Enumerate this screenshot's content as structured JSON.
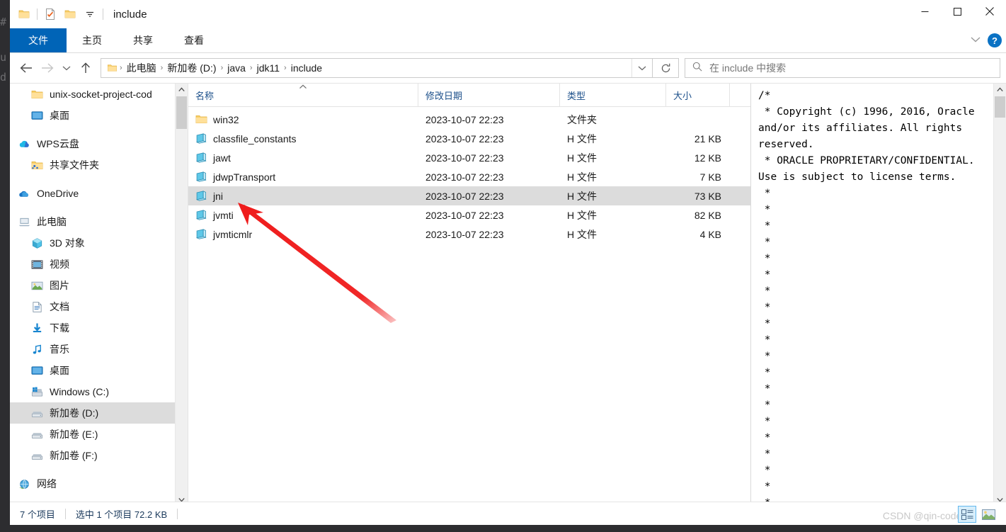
{
  "desktop": {
    "bg_lines": [
      "#",
      "u",
      "d"
    ]
  },
  "window": {
    "title": "include",
    "quick_access": [
      {
        "name": "folder-icon",
        "label": "文件夹"
      },
      {
        "name": "properties-icon",
        "label": "属性"
      },
      {
        "name": "new-folder-icon",
        "label": "新建文件夹"
      },
      {
        "name": "customize-qat-icon",
        "label": "自定义快速访问工具栏"
      }
    ],
    "controls": {
      "minimize": "—",
      "maximize": "☐",
      "close": "✕"
    }
  },
  "ribbon": {
    "tabs": [
      {
        "label": "文件",
        "active": true
      },
      {
        "label": "主页",
        "active": false
      },
      {
        "label": "共享",
        "active": false
      },
      {
        "label": "查看",
        "active": false
      }
    ],
    "collapse_label": "⌄",
    "help_label": "?"
  },
  "navbar": {
    "back_label": "←",
    "forward_label": "→",
    "recent_label": "⌄",
    "up_label": "↑",
    "breadcrumb": [
      "此电脑",
      "新加卷 (D:)",
      "java",
      "jdk11",
      "include"
    ],
    "separator": "›",
    "dropdown_label": "⌄",
    "refresh_label": "↻"
  },
  "search": {
    "placeholder": "在 include 中搜索",
    "icon": "search-icon"
  },
  "sidebar": {
    "items": [
      {
        "label": "unix-socket-project-cod",
        "icon": "folder-icon",
        "indent": 1,
        "selected": false
      },
      {
        "label": "桌面",
        "icon": "desktop-icon",
        "indent": 1,
        "selected": false
      },
      {
        "gap": true
      },
      {
        "label": "WPS云盘",
        "icon": "wps-cloud-icon",
        "indent": 0,
        "selected": false
      },
      {
        "label": "共享文件夹",
        "icon": "shared-folder-icon",
        "indent": 1,
        "selected": false
      },
      {
        "gap": true
      },
      {
        "label": "OneDrive",
        "icon": "onedrive-icon",
        "indent": 0,
        "selected": false
      },
      {
        "gap": true
      },
      {
        "label": "此电脑",
        "icon": "this-pc-icon",
        "indent": 0,
        "selected": false
      },
      {
        "label": "3D 对象",
        "icon": "3d-objects-icon",
        "indent": 1,
        "selected": false
      },
      {
        "label": "视频",
        "icon": "videos-icon",
        "indent": 1,
        "selected": false
      },
      {
        "label": "图片",
        "icon": "pictures-icon",
        "indent": 1,
        "selected": false
      },
      {
        "label": "文档",
        "icon": "documents-icon",
        "indent": 1,
        "selected": false
      },
      {
        "label": "下载",
        "icon": "downloads-icon",
        "indent": 1,
        "selected": false
      },
      {
        "label": "音乐",
        "icon": "music-icon",
        "indent": 1,
        "selected": false
      },
      {
        "label": "桌面",
        "icon": "desktop-icon",
        "indent": 1,
        "selected": false
      },
      {
        "label": "Windows (C:)",
        "icon": "windows-drive-icon",
        "indent": 1,
        "selected": false
      },
      {
        "label": "新加卷 (D:)",
        "icon": "drive-icon",
        "indent": 1,
        "selected": true
      },
      {
        "label": "新加卷 (E:)",
        "icon": "drive-icon",
        "indent": 1,
        "selected": false
      },
      {
        "label": "新加卷 (F:)",
        "icon": "drive-icon",
        "indent": 1,
        "selected": false
      },
      {
        "gap": true
      },
      {
        "label": "网络",
        "icon": "network-icon",
        "indent": 0,
        "selected": false
      }
    ]
  },
  "filelist": {
    "columns": [
      "名称",
      "修改日期",
      "类型",
      "大小"
    ],
    "sort_column": 0,
    "rows": [
      {
        "name": "win32",
        "date": "2023-10-07 22:23",
        "type": "文件夹",
        "size": "",
        "icon": "folder-icon",
        "selected": false
      },
      {
        "name": "classfile_constants",
        "date": "2023-10-07 22:23",
        "type": "H 文件",
        "size": "21 KB",
        "icon": "h-file-icon",
        "selected": false
      },
      {
        "name": "jawt",
        "date": "2023-10-07 22:23",
        "type": "H 文件",
        "size": "12 KB",
        "icon": "h-file-icon",
        "selected": false
      },
      {
        "name": "jdwpTransport",
        "date": "2023-10-07 22:23",
        "type": "H 文件",
        "size": "7 KB",
        "icon": "h-file-icon",
        "selected": false
      },
      {
        "name": "jni",
        "date": "2023-10-07 22:23",
        "type": "H 文件",
        "size": "73 KB",
        "icon": "h-file-icon",
        "selected": true
      },
      {
        "name": "jvmti",
        "date": "2023-10-07 22:23",
        "type": "H 文件",
        "size": "82 KB",
        "icon": "h-file-icon",
        "selected": false
      },
      {
        "name": "jvmticmlr",
        "date": "2023-10-07 22:23",
        "type": "H 文件",
        "size": "4 KB",
        "icon": "h-file-icon",
        "selected": false
      }
    ]
  },
  "preview": {
    "content": "/*\n * Copyright (c) 1996, 2016, Oracle and/or its affiliates. All rights reserved.\n * ORACLE PROPRIETARY/CONFIDENTIAL. Use is subject to license terms.\n *\n *\n *\n *\n *\n *\n *\n *\n *\n *\n *\n *\n *\n *\n *\n *\n *\n *\n *\n *"
  },
  "statusbar": {
    "item_count": "7 个项目",
    "selection": "选中 1 个项目  72.2 KB",
    "views": [
      {
        "name": "details-view",
        "label": "详细信息",
        "active": true
      },
      {
        "name": "large-icons-view",
        "label": "大图标",
        "active": false
      }
    ]
  },
  "watermark": {
    "text": "CSDN @qin-coder"
  },
  "annotation": {
    "color": "#ef1c1c",
    "target": "jni"
  }
}
